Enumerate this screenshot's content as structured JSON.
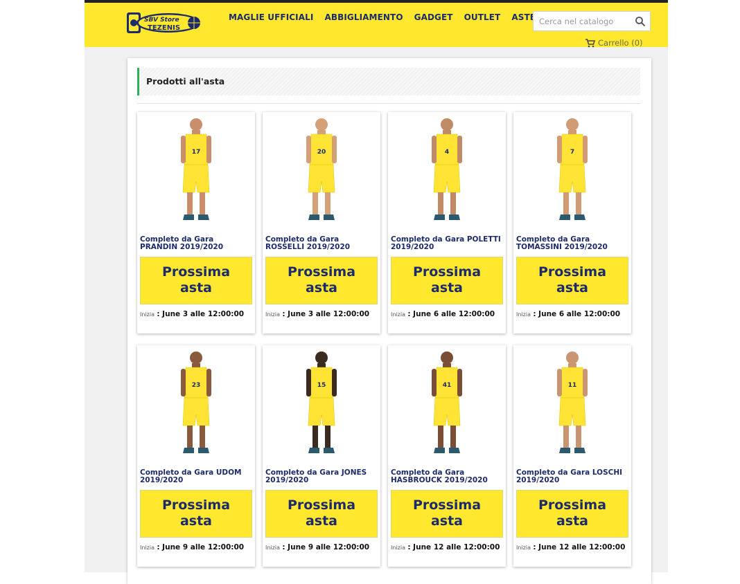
{
  "header": {
    "logo_alt": "SBV Store TEZENIS",
    "nav": [
      "MAGLIE UFFICIALI",
      "ABBIGLIAMENTO",
      "GADGET",
      "OUTLET",
      "ASTE"
    ],
    "search_placeholder": "Cerca nel catalogo",
    "cart_label": "Carrello (0)"
  },
  "main": {
    "heading": "Prodotti all'asta",
    "cta_label": "Prossima\nasta",
    "start_label": "Inizia",
    "products": [
      {
        "name": "Completo da Gara PRANDIN 2019/2020",
        "date": ": June 3 alle 12:00:00",
        "number": "17"
      },
      {
        "name": "Completo da Gara ROSSELLI 2019/2020",
        "date": ": June 3 alle 12:00:00",
        "number": "20"
      },
      {
        "name": "Completo da Gara POLETTI 2019/2020",
        "date": ": June 6 alle 12:00:00",
        "number": "4"
      },
      {
        "name": "Completo da Gara TOMASSINI 2019/2020",
        "date": ": June 6 alle 12:00:00",
        "number": "7"
      },
      {
        "name": "Completo da Gara UDOM 2019/2020",
        "date": ": June 9 alle 12:00:00",
        "number": "23"
      },
      {
        "name": "Completo da Gara JONES 2019/2020",
        "date": ": June 9 alle 12:00:00",
        "number": "15"
      },
      {
        "name": "Completo da Gara HASBROUCK 2019/2020",
        "date": ": June 12 alle 12:00:00",
        "number": "41"
      },
      {
        "name": "Completo da Gara LOSCHI 2019/2020",
        "date": ": June 12 alle 12:00:00",
        "number": "11"
      }
    ]
  },
  "colors": {
    "header_bg": "#ffe82e",
    "accent_navy": "#1d2a6b",
    "heading_border": "#2fb05a"
  },
  "icons": {
    "search": "search-icon",
    "cart": "cart-icon"
  }
}
